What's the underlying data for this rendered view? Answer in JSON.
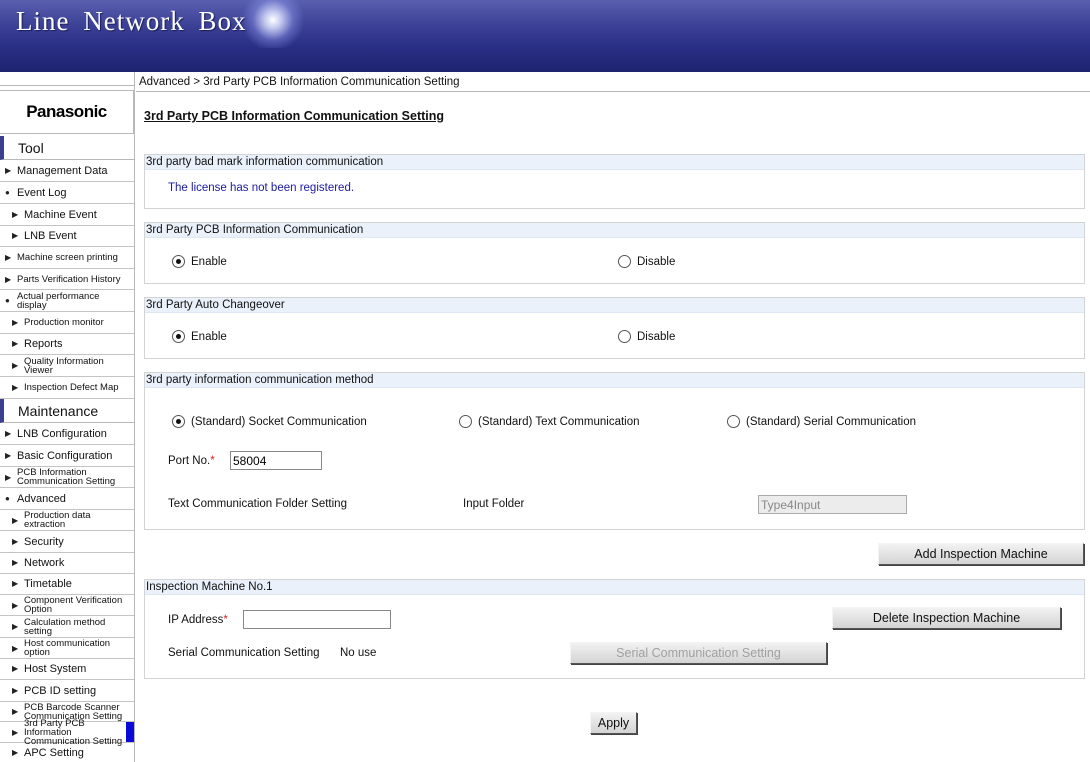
{
  "app": {
    "title": "Line Network Box"
  },
  "sidebar": {
    "logo": "Panasonic",
    "tool_header": "Tool",
    "maintenance_header": "Maintenance",
    "tool_items": [
      {
        "label": "Management Data",
        "marker": "▶"
      },
      {
        "label": "Event Log",
        "marker": "●"
      },
      {
        "label": "Machine Event",
        "marker": "▶"
      },
      {
        "label": "LNB Event",
        "marker": "▶"
      },
      {
        "label": "Machine screen printing",
        "marker": "▶"
      },
      {
        "label": "Parts Verification History",
        "marker": "▶"
      },
      {
        "label": "Actual performance display",
        "marker": "●"
      },
      {
        "label": "Production monitor",
        "marker": "▶"
      },
      {
        "label": "Reports",
        "marker": "▶"
      },
      {
        "label": "Quality Information Viewer",
        "marker": "▶"
      },
      {
        "label": "Inspection Defect Map",
        "marker": "▶"
      }
    ],
    "maint_items": [
      {
        "label": "LNB Configuration",
        "marker": "▶"
      },
      {
        "label": "Basic Configuration",
        "marker": "▶"
      },
      {
        "label": "PCB Information Communication Setting",
        "marker": "▶"
      },
      {
        "label": "Advanced",
        "marker": "●"
      },
      {
        "label": "Production data extraction",
        "marker": "▶"
      },
      {
        "label": "Security",
        "marker": "▶"
      },
      {
        "label": "Network",
        "marker": "▶"
      },
      {
        "label": "Timetable",
        "marker": "▶"
      },
      {
        "label": "Component Verification Option",
        "marker": "▶"
      },
      {
        "label": "Calculation method setting",
        "marker": "▶"
      },
      {
        "label": "Host communication option",
        "marker": "▶"
      },
      {
        "label": "Host System",
        "marker": "▶"
      },
      {
        "label": "PCB ID setting",
        "marker": "▶"
      },
      {
        "label": "PCB Barcode Scanner Communication Setting",
        "marker": "▶"
      },
      {
        "label": "3rd Party PCB Information Communication Setting",
        "marker": "▶"
      },
      {
        "label": "APC Setting",
        "marker": "▶"
      }
    ]
  },
  "breadcrumb": "Advanced > 3rd Party PCB Information Communication Setting",
  "page_title": "3rd Party PCB Information Communication Setting",
  "bad_mark": {
    "header": "3rd party bad mark information communication",
    "message": "The license has not been registered."
  },
  "pcb_info": {
    "header": "3rd Party PCB Information Communication",
    "enable": "Enable",
    "disable": "Disable",
    "selected": "Enable"
  },
  "auto_changeover": {
    "header": "3rd Party Auto Changeover",
    "enable": "Enable",
    "disable": "Disable",
    "selected": "Enable"
  },
  "method": {
    "header": "3rd party information communication method",
    "socket": "(Standard) Socket Communication",
    "text": "(Standard) Text Communication",
    "serial": "(Standard) Serial Communication",
    "selected": "socket",
    "port_label": "Port No.",
    "required_mark": "*",
    "port_value": "58004",
    "folder_setting_label": "Text Communication Folder Setting",
    "input_folder_label": "Input Folder",
    "input_folder_value": "Type4Input"
  },
  "add_machine_button": "Add Inspection Machine",
  "machine": {
    "header": "Inspection Machine No.1",
    "ip_label": "IP Address",
    "required_mark": "*",
    "ip_value": "",
    "delete_button": "Delete Inspection Machine",
    "serial_label": "Serial Communication Setting",
    "serial_value": "No use",
    "serial_button": "Serial Communication Setting"
  },
  "apply_button": "Apply",
  "colors": {
    "banner": "#2a2f86",
    "panel_header": "#eaf1fb",
    "active_marker": "#0b0bd8",
    "required": "#e02020",
    "message": "#1a1aa0"
  }
}
